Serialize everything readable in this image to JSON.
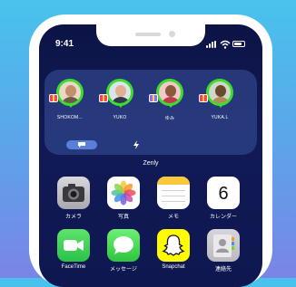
{
  "status_bar": {
    "time": "9:41"
  },
  "widget": {
    "title": "Zenly",
    "friends": [
      {
        "name": "SHOKOM..."
      },
      {
        "name": "YUKO"
      },
      {
        "name": "ゆみ"
      },
      {
        "name": "YUKA.L"
      }
    ]
  },
  "apps": [
    {
      "label": "カメラ",
      "icon": "camera-icon"
    },
    {
      "label": "写真",
      "icon": "photos-icon"
    },
    {
      "label": "メモ",
      "icon": "notes-icon"
    },
    {
      "label": "カレンダー",
      "icon": "calendar-icon",
      "day": "6"
    },
    {
      "label": "FaceTime",
      "icon": "facetime-icon"
    },
    {
      "label": "メッセージ",
      "icon": "messages-icon"
    },
    {
      "label": "Snapchat",
      "icon": "snapchat-icon"
    },
    {
      "label": "連絡先",
      "icon": "contacts-icon"
    }
  ],
  "colors": {
    "background_top": "#48c3ec",
    "background_bottom": "#7b84e6",
    "avatar_ring": "#3edc2c",
    "screen": "#111a55"
  }
}
